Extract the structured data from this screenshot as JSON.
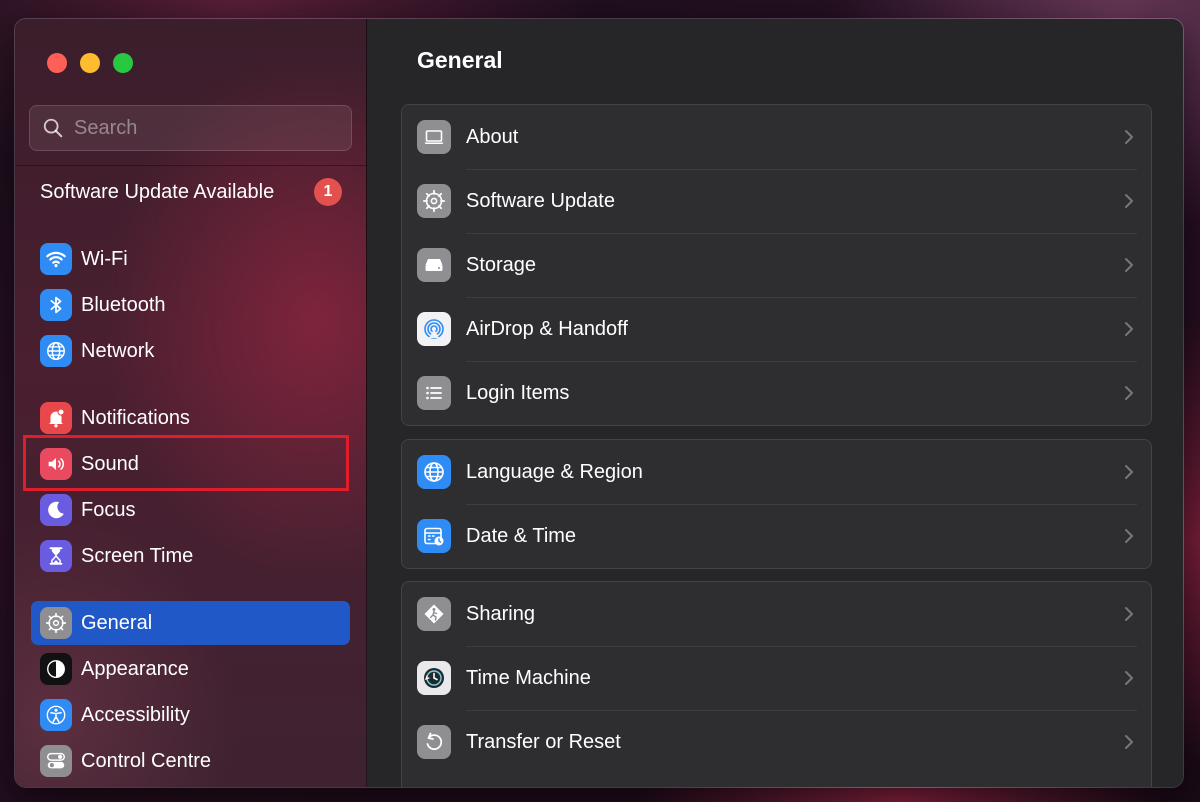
{
  "search": {
    "placeholder": "Search",
    "value": ""
  },
  "sidebar": {
    "update": {
      "label": "Software Update Available",
      "count": "1"
    },
    "items": [
      {
        "key": "wifi",
        "label": "Wi-Fi"
      },
      {
        "key": "bluetooth",
        "label": "Bluetooth"
      },
      {
        "key": "network",
        "label": "Network"
      },
      {
        "key": "notifications",
        "label": "Notifications"
      },
      {
        "key": "sound",
        "label": "Sound"
      },
      {
        "key": "focus",
        "label": "Focus"
      },
      {
        "key": "screen-time",
        "label": "Screen Time"
      },
      {
        "key": "general",
        "label": "General",
        "selected": true
      },
      {
        "key": "appearance",
        "label": "Appearance"
      },
      {
        "key": "accessibility",
        "label": "Accessibility"
      },
      {
        "key": "control-centre",
        "label": "Control Centre"
      }
    ]
  },
  "main": {
    "title": "General",
    "groups": [
      [
        {
          "key": "about",
          "label": "About"
        },
        {
          "key": "software-update",
          "label": "Software Update"
        },
        {
          "key": "storage",
          "label": "Storage"
        },
        {
          "key": "airdrop",
          "label": "AirDrop & Handoff"
        },
        {
          "key": "login-items",
          "label": "Login Items"
        }
      ],
      [
        {
          "key": "language",
          "label": "Language & Region"
        },
        {
          "key": "date-time",
          "label": "Date & Time"
        }
      ],
      [
        {
          "key": "sharing",
          "label": "Sharing"
        },
        {
          "key": "time-machine",
          "label": "Time Machine"
        },
        {
          "key": "transfer-reset",
          "label": "Transfer or Reset"
        }
      ]
    ]
  },
  "colors": {
    "selected": "#2059c7",
    "highlight": "#e01e2b",
    "badge": "#e2514d"
  }
}
